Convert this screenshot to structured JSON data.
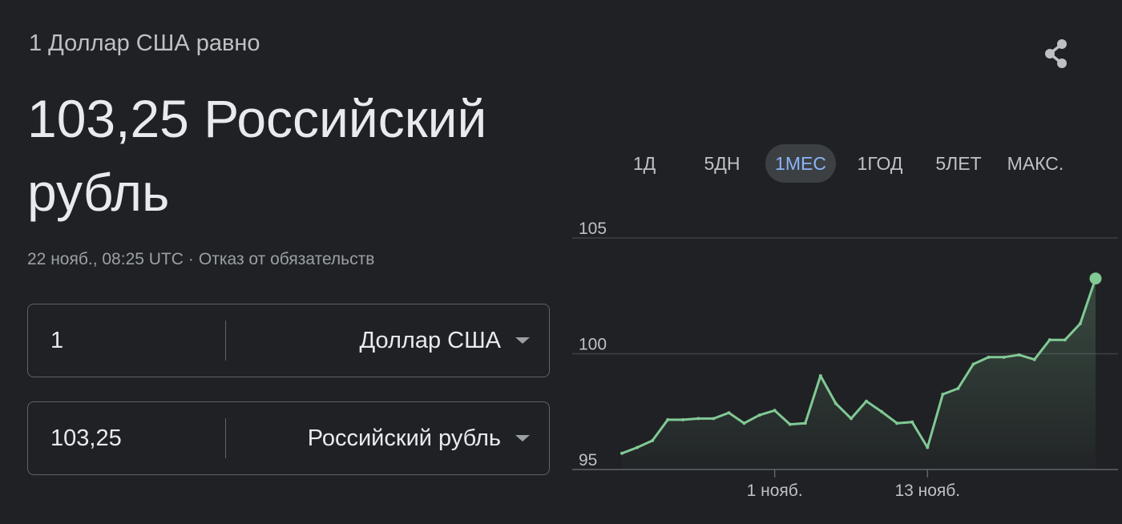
{
  "header": {
    "subtitle": "1 Доллар США равно",
    "main_value": "103,25 Российский рубль",
    "timestamp": "22 нояб., 08:25 UTC",
    "separator": "·",
    "disclaimer_link": "Отказ от обязательств"
  },
  "converter": {
    "from": {
      "amount": "1",
      "currency": "Доллар США"
    },
    "to": {
      "amount": "103,25",
      "currency": "Российский рубль"
    }
  },
  "share": {
    "icon": "share-icon"
  },
  "tabs": [
    {
      "label": "1Д",
      "active": false
    },
    {
      "label": "5ДН",
      "active": false
    },
    {
      "label": "1МЕС",
      "active": true
    },
    {
      "label": "1ГОД",
      "active": false
    },
    {
      "label": "5ЛЕТ",
      "active": false
    },
    {
      "label": "МАКС.",
      "active": false
    }
  ],
  "chart_data": {
    "type": "area",
    "x_tick_labels": [
      "1 нояб.",
      "13 нояб."
    ],
    "y_ticks": [
      95,
      100,
      105
    ],
    "ylim": [
      95,
      105
    ],
    "grid": true,
    "line_color": "#81c995",
    "values": [
      95.7,
      95.95,
      96.25,
      97.15,
      97.15,
      97.2,
      97.2,
      97.45,
      97.0,
      97.35,
      97.55,
      96.95,
      97.0,
      99.05,
      97.85,
      97.2,
      97.95,
      97.5,
      97.0,
      97.05,
      95.95,
      98.25,
      98.5,
      99.55,
      99.85,
      99.85,
      99.95,
      99.75,
      100.6,
      100.6,
      101.3,
      103.25
    ]
  }
}
